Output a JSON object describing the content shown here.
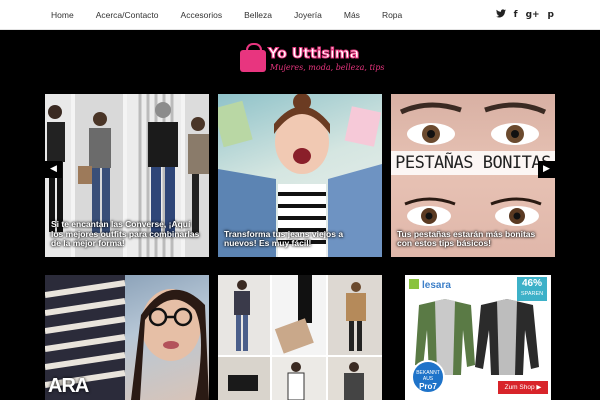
{
  "nav": {
    "items": [
      "Home",
      "Acerca/Contacto",
      "Accesorios",
      "Belleza",
      "Joyería",
      "Más",
      "Ropa"
    ]
  },
  "social": {
    "icons": [
      "twitter-icon",
      "facebook-icon",
      "google-plus-icon",
      "pinterest-icon"
    ],
    "twitter": "𝕥",
    "facebook": "f",
    "google": "g+",
    "pinterest": "p"
  },
  "logo": {
    "title": "Yo Uttisima",
    "tagline": "Mujeres, moda, belleza, tips"
  },
  "slider": {
    "prev": "◀",
    "next": "▶",
    "slides": [
      {
        "caption": "Si te encantan las Converse, ¡Aquí los mejores outfits para combinarlas de la mejor forma!"
      },
      {
        "caption": "Transforma tus jeans viejos a nuevos! Es muy fácil!"
      },
      {
        "caption": "Tus pestañas estarán más bonitas con estos tips básicos!",
        "overlay_text": "PESTAÑAS BONITAS"
      }
    ]
  },
  "cards": {
    "card1_text": "ARA",
    "ad": {
      "brand": "lesara",
      "discount": "46%",
      "discount_label": "SPAREN",
      "badge_top": "BEKANNT AUS",
      "badge_main": "Pro7",
      "button": "Zum Shop ▶"
    }
  },
  "colors": {
    "accent": "#e8357f",
    "background": "#000000",
    "nav_bg": "#ffffff"
  }
}
